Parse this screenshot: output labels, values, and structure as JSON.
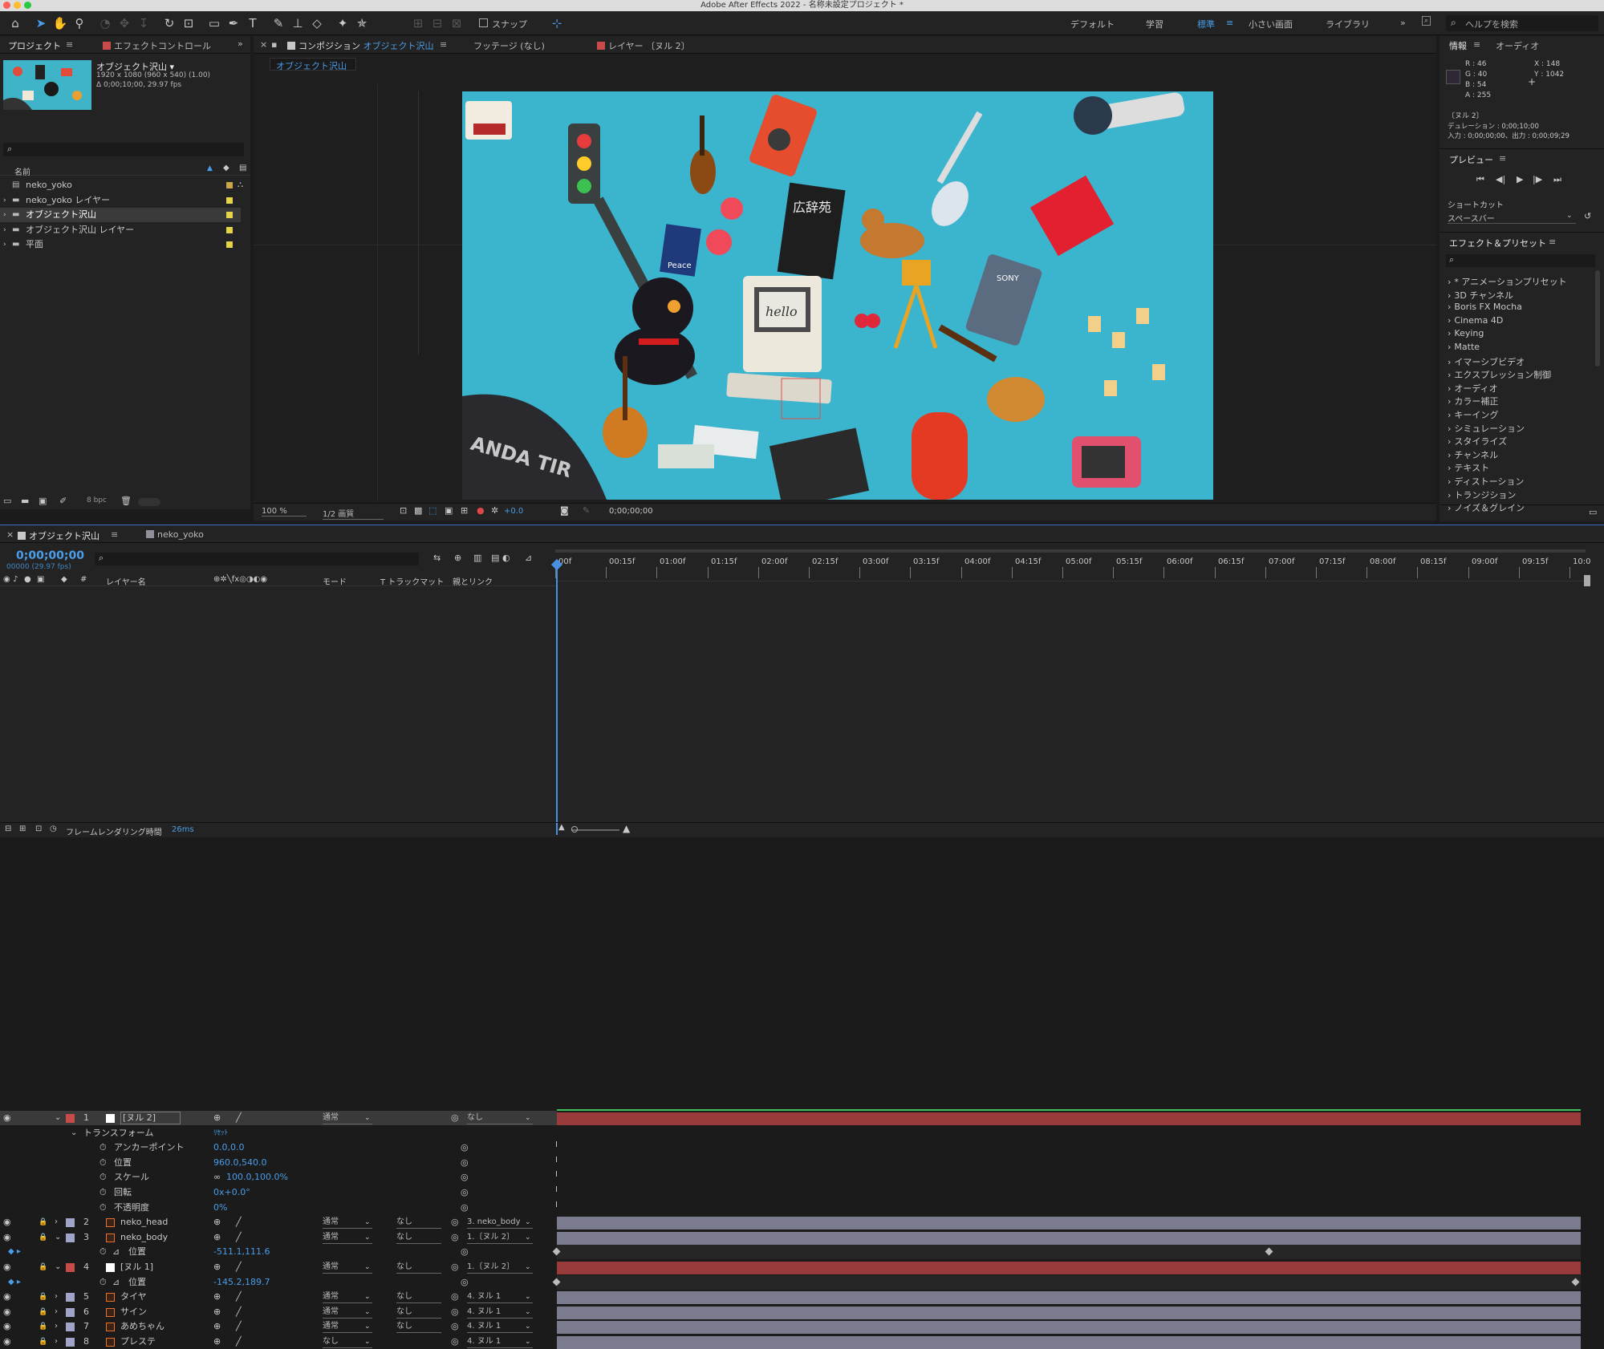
{
  "app": {
    "title": "Adobe After Effects 2022 - 名称未設定プロジェクト *"
  },
  "toolbar": {
    "snap_label": "スナップ",
    "workspaces": [
      "デフォルト",
      "学習",
      "標準",
      "小さい画面",
      "ライブラリ"
    ],
    "help_placeholder": "ヘルプを検索"
  },
  "project": {
    "tab": "プロジェクト",
    "effect_tab": "エフェクトコントロール",
    "comp_name": "オブジェクト沢山 ▾",
    "comp_info1": "1920 x 1080 (960 x 540) (1.00)",
    "comp_info2": "Δ 0;00;10;00, 29.97 fps",
    "col_name": "名前",
    "items": [
      {
        "name": "neko_yoko",
        "color": "#c9a64a"
      },
      {
        "name": "neko_yoko レイヤー",
        "color": "#e6d44a"
      },
      {
        "name": "オブジェクト沢山",
        "color": "#e6d44a"
      },
      {
        "name": "オブジェクト沢山 レイヤー",
        "color": "#e6d44a"
      },
      {
        "name": "平面",
        "color": "#e6d44a"
      }
    ],
    "bpc": "8 bpc"
  },
  "comp": {
    "tab_prefix": "コンポジション",
    "tab_name": "オブジェクト沢山",
    "footage_tab": "フッテージ (なし)",
    "layer_tab": "レイヤー 〔ヌル 2〕",
    "subtab": "オブジェクト沢山",
    "zoom": "100 %",
    "resolution": "1/2 画質",
    "exposure": "+0.0",
    "timecode": "0;00;00;00"
  },
  "info": {
    "tab": "情報",
    "audio_tab": "オーディオ",
    "r": "R : 46",
    "g": "G : 40",
    "b": "B : 54",
    "a": "A : 255",
    "x": "X : 148",
    "y": "Y : 1042",
    "layer": "〔ヌル 2〕",
    "duration": "デュレーション : 0;00;10;00",
    "inout": "入力 : 0;00;00;00、出力 : 0;00;09;29"
  },
  "preview": {
    "title": "プレビュー",
    "shortcut_label": "ショートカット",
    "shortcut_value": "スペースバー"
  },
  "effects": {
    "title": "エフェクト＆プリセット",
    "items": [
      "* アニメーションプリセット",
      "3D チャンネル",
      "Boris FX Mocha",
      "Cinema 4D",
      "Keying",
      "Matte",
      "イマーシブビデオ",
      "エクスプレッション制御",
      "オーディオ",
      "カラー補正",
      "キーイング",
      "シミュレーション",
      "スタイライズ",
      "チャンネル",
      "テキスト",
      "ディストーション",
      "トランジション",
      "ノイズ＆グレイン"
    ]
  },
  "timeline": {
    "tab": "オブジェクト沢山",
    "tab2": "neko_yoko",
    "timecode": "0;00;00;00",
    "fps": "00000 (29.97 fps)",
    "col_layer": "レイヤー名",
    "col_mode": "モード",
    "col_track": "T トラックマット",
    "col_parent": "親とリンク",
    "ruler": [
      "00f",
      "00:15f",
      "01:00f",
      "01:15f",
      "02:00f",
      "02:15f",
      "03:00f",
      "03:15f",
      "04:00f",
      "04:15f",
      "05:00f",
      "05:15f",
      "06:00f",
      "06:15f",
      "07:00f",
      "07:15f",
      "08:00f",
      "08:15f",
      "09:00f",
      "09:15f",
      "10:0"
    ],
    "layers": [
      {
        "num": "1",
        "name": "[ヌル 2]",
        "mode": "通常",
        "track": "",
        "parent": "なし",
        "color": "#c94a4a"
      },
      {
        "num": "2",
        "name": "neko_head",
        "mode": "通常",
        "track": "なし",
        "parent": "3. neko_body",
        "color": "#a0a4c8"
      },
      {
        "num": "3",
        "name": "neko_body",
        "mode": "通常",
        "track": "なし",
        "parent": "1.〔ヌル 2〕",
        "color": "#a0a4c8"
      },
      {
        "num": "4",
        "name": "[ヌル 1]",
        "mode": "通常",
        "track": "なし",
        "parent": "1.〔ヌル 2〕",
        "color": "#c94a4a"
      },
      {
        "num": "5",
        "name": "タイヤ",
        "mode": "通常",
        "track": "なし",
        "parent": "4. ヌル 1",
        "color": "#a0a4c8"
      },
      {
        "num": "6",
        "name": "サイン",
        "mode": "通常",
        "track": "なし",
        "parent": "4. ヌル 1",
        "color": "#a0a4c8"
      },
      {
        "num": "7",
        "name": "あめちゃん",
        "mode": "通常",
        "track": "なし",
        "parent": "4. ヌル 1",
        "color": "#a0a4c8"
      },
      {
        "num": "8",
        "name": "プレステ",
        "mode": "なし",
        "track": "",
        "parent": "4. ヌル 1",
        "color": "#a0a4c8"
      }
    ],
    "transform": {
      "label": "トランスフォーム",
      "reset": "ﾘｾｯﾄ",
      "anchor_label": "アンカーポイント",
      "anchor": "0.0,0.0",
      "position_label": "位置",
      "position": "960.0,540.0",
      "scale_label": "スケール",
      "scale": "100.0,100.0%",
      "rotation_label": "回転",
      "rotation": "0x+0.0°",
      "opacity_label": "不透明度",
      "opacity": "0%"
    },
    "pos3_label": "位置",
    "pos3": "-511.1,111.6",
    "pos4_label": "位置",
    "pos4": "-145.2,189.7",
    "render_label": "フレームレンダリング時間",
    "render_value": "26ms"
  },
  "canvas_text": {
    "tire": "ANDA TIR",
    "peace": "Peace",
    "hello": "hello",
    "dict": "広辞苑",
    "sony": "SONY"
  }
}
